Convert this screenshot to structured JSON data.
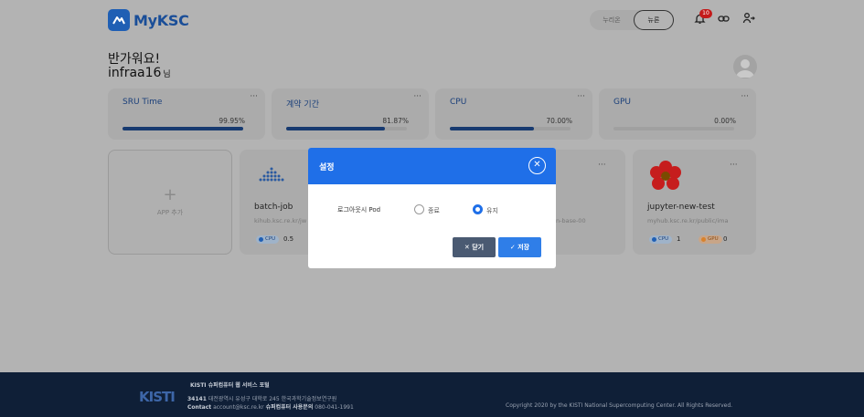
{
  "header": {
    "app_name": "MyKSC",
    "toggle_options": [
      "누리온",
      "뉴론"
    ],
    "selected_system": "뉴론",
    "notification_count": "10"
  },
  "greeting": {
    "line1": "반가워요!",
    "username": "infraa16",
    "suffix": "님"
  },
  "usage_cards": [
    {
      "label": "SRU Time",
      "value_text": "99.95%",
      "progress": 0.9995
    },
    {
      "label": "계약 기간",
      "value_text": "81.87%",
      "progress": 0.8187
    },
    {
      "label": "CPU",
      "value_text": "70.00%",
      "progress": 0.7
    },
    {
      "label": "GPU",
      "value_text": "0.00%",
      "progress": 0.0
    }
  ],
  "more_label": "···",
  "apps": {
    "add_label": "APP 추가",
    "items": [
      {
        "name": "batch-job",
        "url": "kihub.ksc.re.kr/jw",
        "cpu_label": "CPU",
        "cpu": "0.5"
      },
      {
        "url_tail": "n-base-00"
      },
      {
        "name": "jupyter-new-test",
        "url": "myhub.ksc.re.kr/public/ima",
        "cpu_label": "CPU",
        "cpu": "1",
        "gpu_label": "GPU",
        "gpu": "0"
      }
    ]
  },
  "modal": {
    "title": "설정",
    "field_label": "로그아웃시 Pod",
    "options": [
      "종료",
      "유지"
    ],
    "selected": "유지",
    "close_label": "닫기",
    "save_label": "저장"
  },
  "footer": {
    "org_logo_text": "KISTI",
    "portal_name": "KISTI 슈퍼컴퓨터 웹 서비스 포털",
    "address_postal": "34141",
    "address": "대전광역시 유성구 대학로 245 한국과학기술정보연구원",
    "contact_label": "Contact",
    "contact_email": "account@ksc.re.kr",
    "center_label": "슈퍼컴퓨터 사용문의",
    "phone": "080-041-1991",
    "copyright": "Copyright 2020 by the KISTI National Supercomputing Center. All Rights Reserved."
  }
}
